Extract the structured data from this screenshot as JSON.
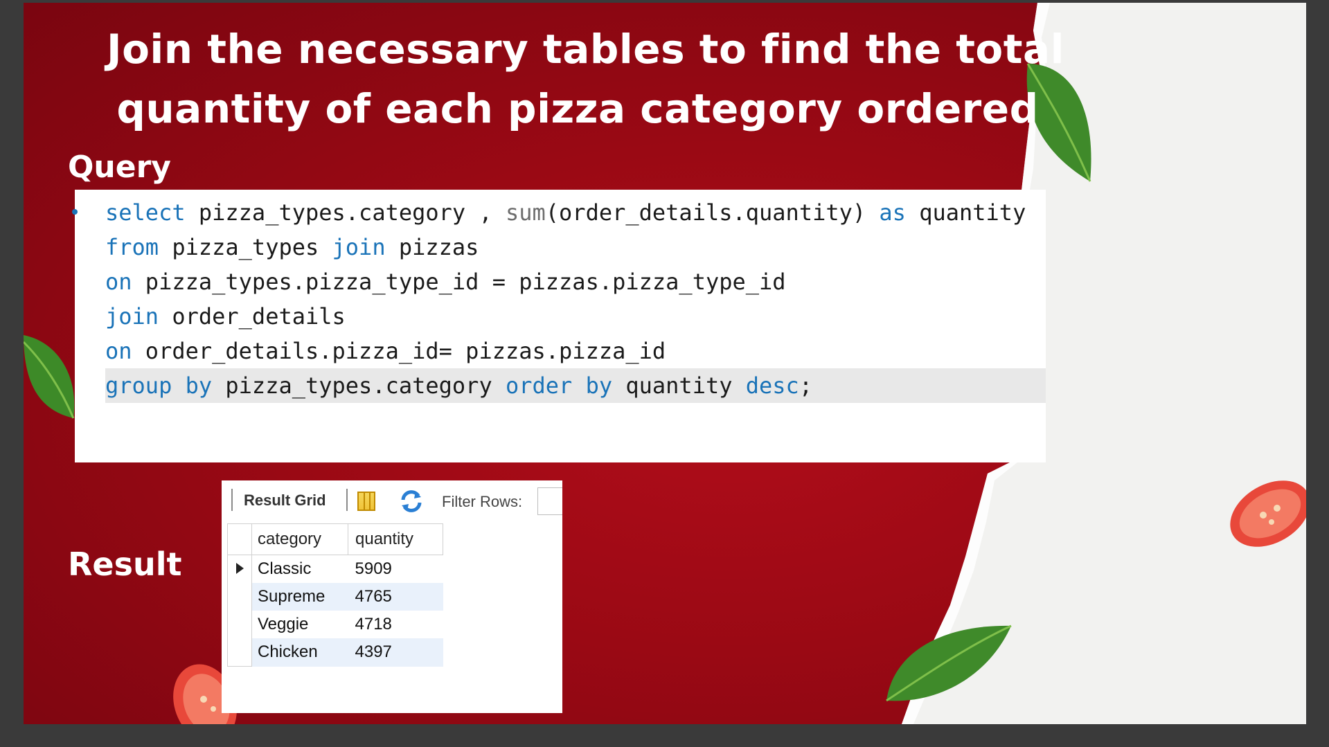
{
  "title": {
    "line1": "Join the necessary tables to find the total",
    "line2": "quantity of each pizza category ordered"
  },
  "labels": {
    "query": "Query",
    "result": "Result"
  },
  "query": {
    "lines": [
      [
        {
          "t": "select",
          "k": "kw"
        },
        {
          "t": " pizza_types.category , "
        },
        {
          "t": "sum",
          "k": "fn"
        },
        {
          "t": "(order_details.quantity) "
        },
        {
          "t": "as",
          "k": "kw"
        },
        {
          "t": " quantity"
        }
      ],
      [
        {
          "t": "from",
          "k": "kw"
        },
        {
          "t": " pizza_types "
        },
        {
          "t": "join",
          "k": "kw"
        },
        {
          "t": " pizzas"
        }
      ],
      [
        {
          "t": "on",
          "k": "kw"
        },
        {
          "t": " pizza_types.pizza_type_id = pizzas.pizza_type_id"
        }
      ],
      [
        {
          "t": "join",
          "k": "kw"
        },
        {
          "t": " order_details"
        }
      ],
      [
        {
          "t": "on",
          "k": "kw"
        },
        {
          "t": " order_details.pizza_id= pizzas.pizza_id"
        }
      ],
      [
        {
          "t": "group by",
          "k": "kw"
        },
        {
          "t": " pizza_types.category "
        },
        {
          "t": "order by",
          "k": "kw"
        },
        {
          "t": " quantity "
        },
        {
          "t": "desc",
          "k": "kw"
        },
        {
          "t": ";"
        }
      ]
    ]
  },
  "result_grid": {
    "toolbar": {
      "result_grid_label": "Result Grid",
      "filter_label": "Filter Rows:",
      "grid_icon": "grid-view-icon",
      "refresh_icon": "refresh-icon"
    },
    "columns": [
      "category",
      "quantity"
    ],
    "rows": [
      {
        "category": "Classic",
        "quantity": "5909"
      },
      {
        "category": "Supreme",
        "quantity": "4765"
      },
      {
        "category": "Veggie",
        "quantity": "4718"
      },
      {
        "category": "Chicken",
        "quantity": "4397"
      }
    ]
  },
  "colors": {
    "background_red": "#9a0914",
    "keyword_blue": "#1a73b8",
    "function_gray": "#6d6d6d",
    "highlight_line": "#e8e8e8"
  }
}
